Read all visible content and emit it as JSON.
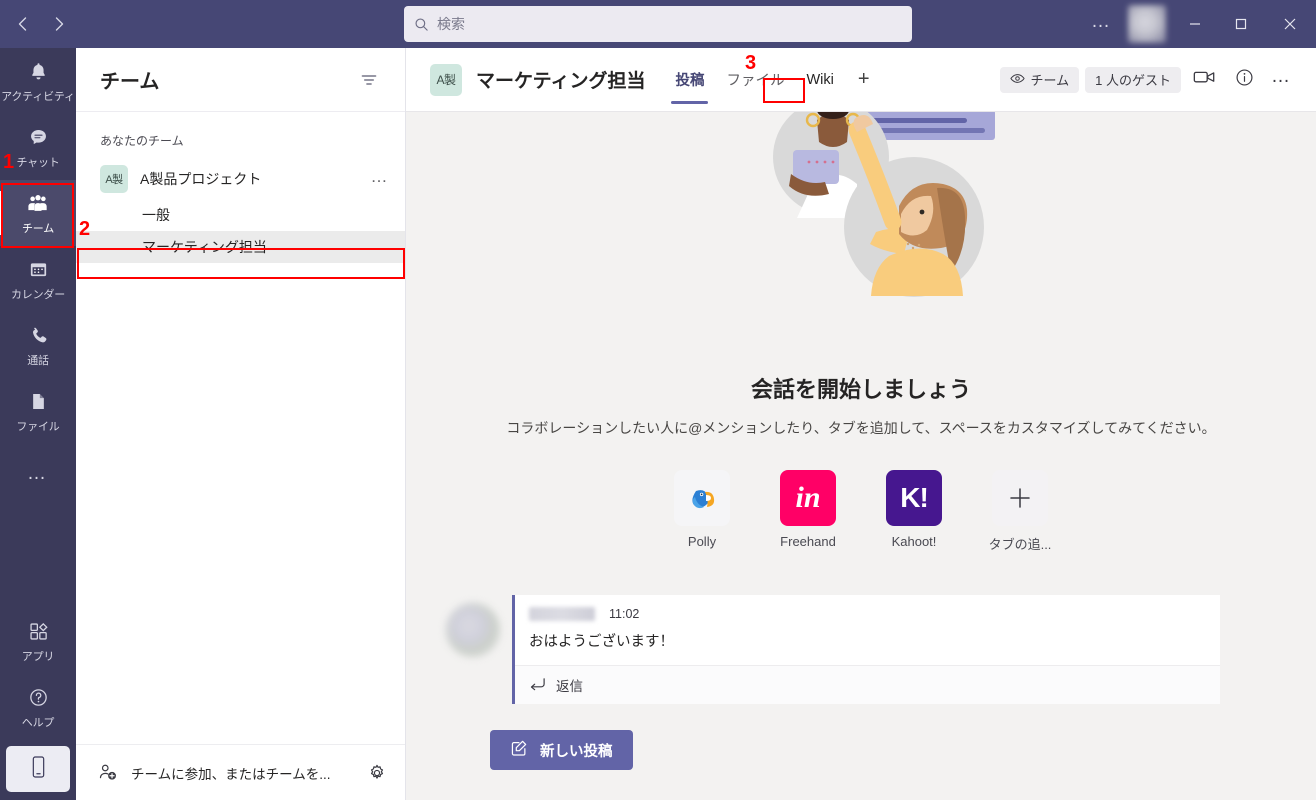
{
  "titlebar": {
    "back_label": "戻る",
    "forward_label": "進む",
    "search_placeholder": "検索",
    "overflow_label": "…",
    "minimize_label": "最小化",
    "maximize_label": "最大化",
    "close_label": "閉じる"
  },
  "rail": {
    "items": [
      {
        "label": "アクティビティ",
        "icon": "bell-icon",
        "active": false
      },
      {
        "label": "チャット",
        "icon": "chat-icon",
        "active": false
      },
      {
        "label": "チーム",
        "icon": "teams-icon",
        "active": true
      },
      {
        "label": "カレンダー",
        "icon": "calendar-icon",
        "active": false
      },
      {
        "label": "通話",
        "icon": "phone-call-icon",
        "active": false
      },
      {
        "label": "ファイル",
        "icon": "file-icon",
        "active": false
      }
    ],
    "more_label": "…",
    "bottom_items": [
      {
        "label": "アプリ",
        "icon": "apps-icon"
      },
      {
        "label": "ヘルプ",
        "icon": "help-icon"
      }
    ],
    "mobile_label": "モバイルアプリを入手"
  },
  "teams_panel": {
    "title": "チーム",
    "filter_label": "フィルター",
    "section_label": "あなたのチーム",
    "team": {
      "avatar_text": "A製",
      "name": "A製品プロジェクト",
      "more_label": "…",
      "channels": [
        {
          "name": "一般",
          "selected": false
        },
        {
          "name": "マーケティング担当",
          "selected": true
        }
      ]
    },
    "footer": {
      "join_label": "チームに参加、またはチームを...",
      "settings_label": "設定"
    }
  },
  "main_header": {
    "team_avatar_text": "A製",
    "channel_title": "マーケティング担当",
    "tabs": [
      {
        "label": "投稿",
        "active": true,
        "boxed": false
      },
      {
        "label": "ファイル",
        "active": false,
        "boxed": false
      },
      {
        "label": "Wiki",
        "active": false,
        "boxed": true
      }
    ],
    "add_tab_label": "+",
    "team_pill_label": "チーム",
    "guest_pill_label": "1 人のゲスト",
    "meet_label": "今すぐ会議",
    "info_label": "チャネル情報",
    "more_label": "…"
  },
  "content": {
    "hero_title": "会話を開始しましょう",
    "hero_subtitle": "コラボレーションしたい人に@メンションしたり、タブを追加して、スペースをカスタマイズしてみてください。",
    "apps": [
      {
        "label": "Polly",
        "icon": "polly-icon",
        "bg": "#f5f5f7",
        "fg": "#4a90d9"
      },
      {
        "label": "Freehand",
        "icon": "freehand-icon",
        "bg": "#ff0066",
        "fg": "#ffffff",
        "glyph": "in"
      },
      {
        "label": "Kahoot!",
        "icon": "kahoot-icon",
        "bg": "#46178f",
        "fg": "#ffffff",
        "glyph": "K!"
      },
      {
        "label": "タブの追...",
        "icon": "plus-icon",
        "bg": "#f3f2f4",
        "fg": "#3b3a42",
        "glyph": "+"
      }
    ],
    "message": {
      "sender_masked": true,
      "time": "11:02",
      "text": "おはようございます！",
      "reply_label": "返信"
    },
    "new_post_label": "新しい投稿"
  },
  "annotations": [
    {
      "number": "1",
      "target": "rail-item-teams"
    },
    {
      "number": "2",
      "target": "channel-marketing"
    },
    {
      "number": "3",
      "target": "tab-wiki"
    }
  ],
  "colors": {
    "brand_purple": "#6264a7",
    "titlebar": "#464775",
    "rail": "#3b3a5a",
    "annotation_red": "#ff0000",
    "team_avatar_bg": "#cfe7df"
  }
}
